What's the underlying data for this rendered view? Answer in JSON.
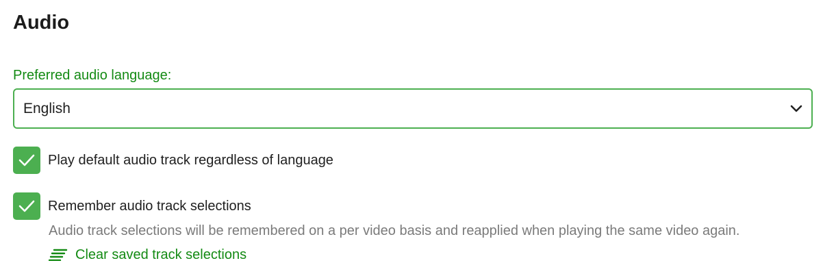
{
  "section": {
    "title": "Audio"
  },
  "preferred_language": {
    "label": "Preferred audio language:",
    "selected": "English"
  },
  "options": [
    {
      "label": "Play default audio track regardless of language",
      "checked": true
    },
    {
      "label": "Remember audio track selections",
      "checked": true,
      "description": "Audio track selections will be remembered on a per video basis and reapplied when playing the same video again."
    }
  ],
  "clear_button": {
    "label": "Clear saved track selections",
    "icon": "clear-list-icon"
  },
  "colors": {
    "accent": "#4caf50",
    "accent_text": "#138a13",
    "text": "#202020",
    "muted": "#7a7a7a"
  }
}
